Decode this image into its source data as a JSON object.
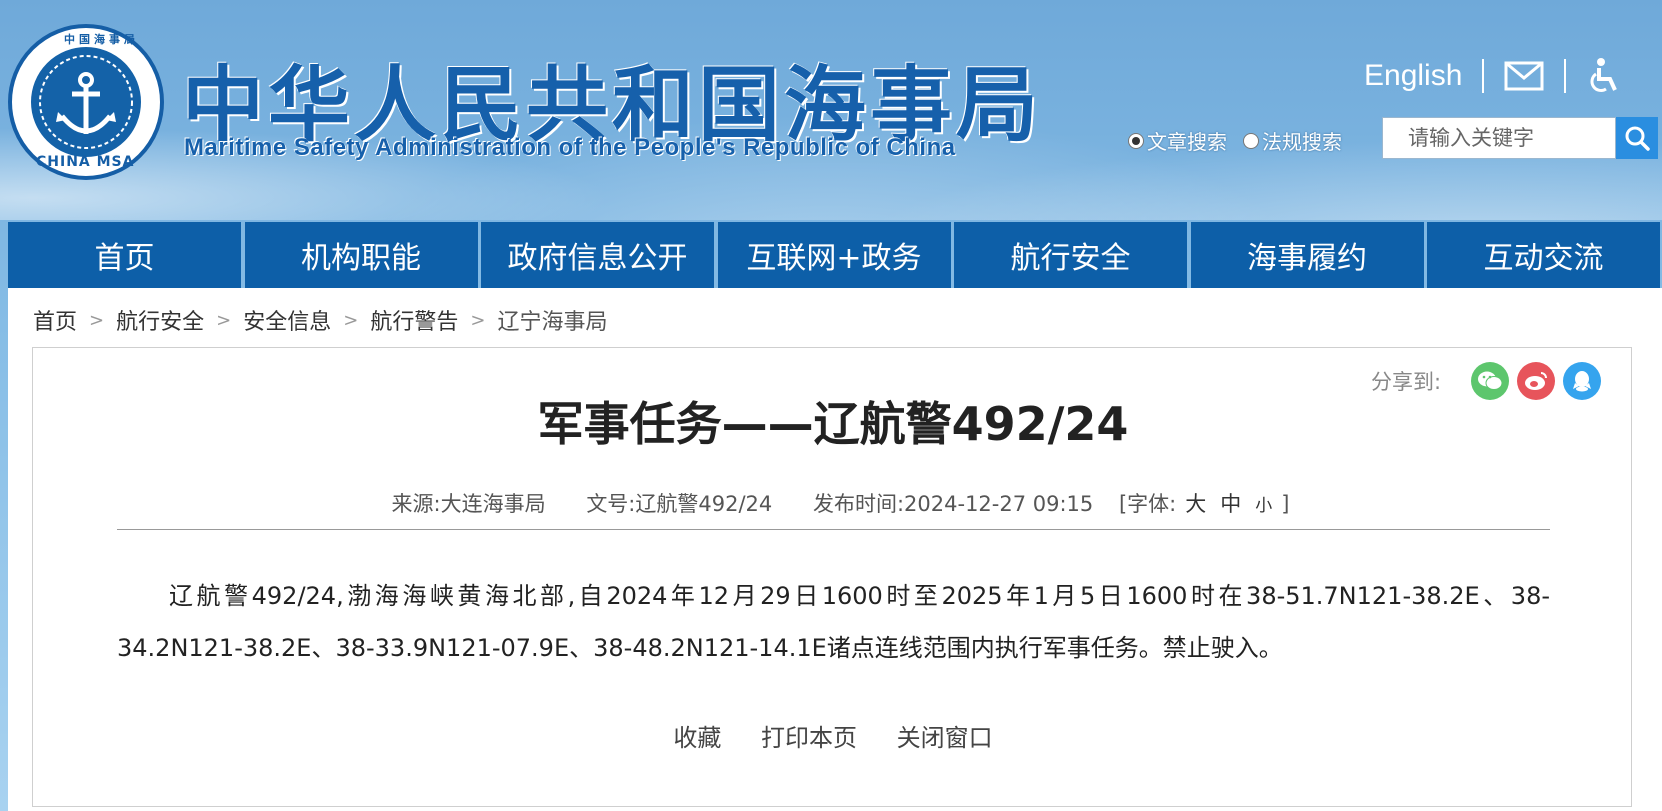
{
  "header": {
    "logo_top_text": "中国海事局",
    "logo_bottom_text": "CHINA MSA",
    "title_cn": "中华人民共和国海事局",
    "title_en": "Maritime Safety Administration of the People's Republic of China",
    "english_link": "English",
    "search": {
      "options": [
        {
          "label": "文章搜索",
          "checked": true
        },
        {
          "label": "法规搜索",
          "checked": false
        }
      ],
      "placeholder": "请输入关键字"
    }
  },
  "nav": {
    "items": [
      "首页",
      "机构职能",
      "政府信息公开",
      "互联网+政务",
      "航行安全",
      "海事履约",
      "互动交流"
    ]
  },
  "breadcrumb": [
    "首页",
    "航行安全",
    "安全信息",
    "航行警告",
    "辽宁海事局"
  ],
  "breadcrumb_sep": ">",
  "article": {
    "share_label": "分享到:",
    "share_icons": [
      "wechat-icon",
      "weibo-icon",
      "qq-icon"
    ],
    "title": "军事任务——辽航警492/24",
    "meta": {
      "source": "来源:大连海事局",
      "doc_no": "文号:辽航警492/24",
      "published": "发布时间:2024-12-27 09:15",
      "font_label": "[字体:",
      "font_large": "大",
      "font_medium": "中",
      "font_small": "小",
      "font_close": "]"
    },
    "body": "辽航警492/24,渤海海峡黄海北部,自2024年12月29日1600时至2025年1月5日1600时在38-51.7N121-38.2E、38-34.2N121-38.2E、38-33.9N121-07.9E、38-48.2N121-14.1E诸点连线范围内执行军事任务。禁止驶入。",
    "actions": [
      "收藏",
      "打印本页",
      "关闭窗口"
    ]
  },
  "colors": {
    "nav_bg": "#0d5fa8",
    "title_blue": "#1660ab",
    "search_btn": "#2a8ee0",
    "wechat": "#5dc66d",
    "weibo": "#e7545b",
    "qq": "#35a4ee"
  }
}
